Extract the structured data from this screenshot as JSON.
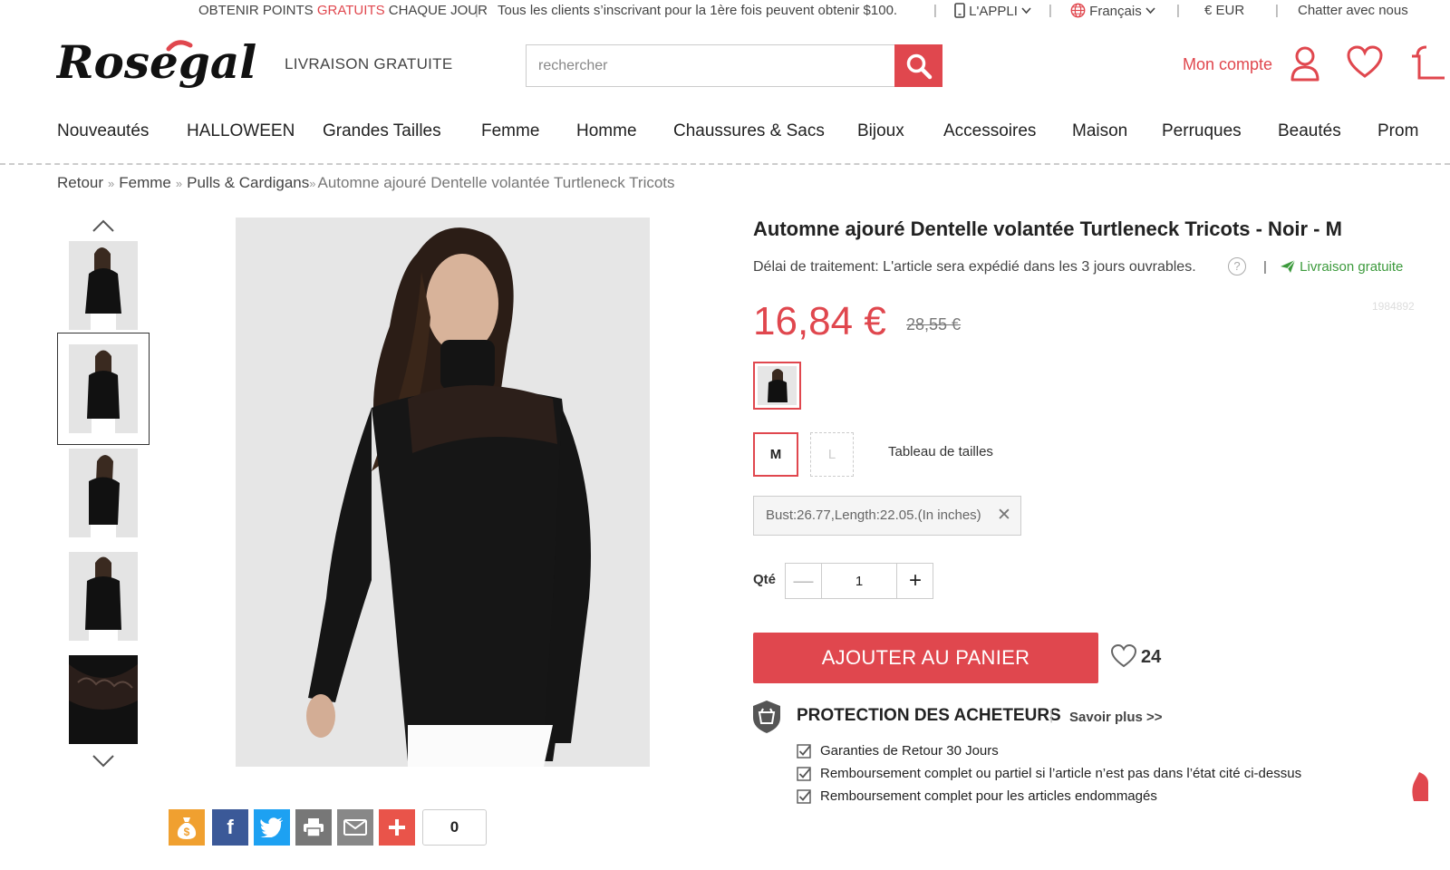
{
  "topbar": {
    "points_prefix": "OBTENIR POINTS ",
    "points_highlight": "GRATUITS",
    "points_suffix": " CHAQUE JOUR",
    "promo": "Tous les clients s’inscrivant pour la 1ère fois peuvent obtenir $100.",
    "app": "L'APPLI",
    "language": "Français",
    "currency": "€ EUR",
    "chat": "Chatter avec nous"
  },
  "header": {
    "logo": "Rosegal",
    "free_shipping": "LIVRAISON GRATUITE",
    "search_placeholder": "rechercher",
    "account": "Mon compte"
  },
  "nav": [
    "Nouveautés",
    "HALLOWEEN",
    "Grandes Tailles",
    "Femme",
    "Homme",
    "Chaussures & Sacs",
    "Bijoux",
    "Accessoires",
    "Maison",
    "Perruques",
    "Beautés",
    "Prom"
  ],
  "breadcrumb": {
    "items": [
      "Retour",
      "Femme",
      "Pulls & Cardigans"
    ],
    "separator": "»",
    "current": "Automne ajouré Dentelle volantée Turtleneck Tricots"
  },
  "product": {
    "title": "Automne ajouré Dentelle volantée Turtleneck Tricots - Noir - M",
    "delay": "Délai de traitement: L'article sera expédié dans les 3 jours ouvrables.",
    "help": "?",
    "sep": "|",
    "shipping": "Livraison gratuite",
    "sku": "1984892",
    "price": "16,84 €",
    "old_price": "28,55 €",
    "sizes": [
      "M",
      "L"
    ],
    "size_chart": "Tableau de tailles",
    "measurements": "Bust:26.77,Length:22.05.(In inches)",
    "qty_label": "Qté",
    "qty": "1",
    "add_to_cart": "AJOUTER AU PANIER",
    "wish_count": "24"
  },
  "protection": {
    "title": "PROTECTION DES ACHETEURS",
    "sep": "|",
    "more": "Savoir plus >>",
    "items": [
      "Garanties de Retour 30 Jours",
      "Remboursement complet ou partiel si l’article n’est pas dans l’état cité ci-dessus",
      "Remboursement complet pour les articles endommagés"
    ]
  },
  "share": {
    "count": "0"
  },
  "colors": {
    "accent": "#e0474e",
    "green": "#3c9a3c"
  }
}
